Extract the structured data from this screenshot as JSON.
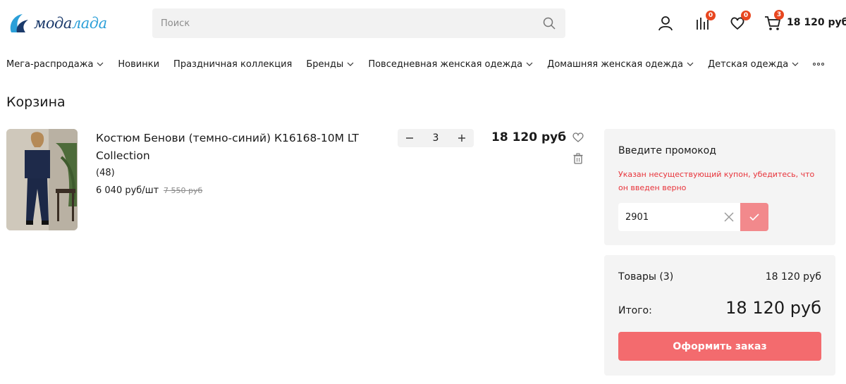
{
  "brand": {
    "logo_prefix": "мода",
    "logo_suffix": "лада",
    "accent": "#2b9fd8",
    "primary": "#1b3a6b"
  },
  "search": {
    "placeholder": "Поиск",
    "value": ""
  },
  "header": {
    "icons": [
      "user-icon",
      "compare-icon",
      "heart-icon",
      "cart-icon"
    ],
    "compare_count": "0",
    "favorites_count": "0",
    "cart_count": "3",
    "cart_total": "18 120 руб",
    "badge_color": "#e8461f"
  },
  "nav": {
    "items": [
      {
        "label": "Мега-распродажа",
        "has_dropdown": true
      },
      {
        "label": "Новинки",
        "has_dropdown": false
      },
      {
        "label": "Праздничная коллекция",
        "has_dropdown": false
      },
      {
        "label": "Бренды",
        "has_dropdown": true
      },
      {
        "label": "Повседневная женская одежда",
        "has_dropdown": true
      },
      {
        "label": "Домашняя женская одежда",
        "has_dropdown": true
      },
      {
        "label": "Детская одежда",
        "has_dropdown": true
      }
    ]
  },
  "page": {
    "title": "Корзина"
  },
  "cart": {
    "items": [
      {
        "name": "Костюм Бенови (темно-синий) К16168-10М LT Collection",
        "reviews": "(48)",
        "unit_price": "6 040 руб/шт",
        "old_price": "7 550 руб",
        "quantity": "3",
        "line_total": "18 120 руб"
      }
    ]
  },
  "promo": {
    "title": "Введите промокод",
    "error": "Указан несуществующий купон, убедитесь, что он введен верно",
    "value": "2901",
    "error_color": "#e8333a",
    "apply_color": "#f2898c"
  },
  "summary": {
    "goods_label": "Товары (3)",
    "goods_value": "18 120 руб",
    "total_label": "Итого:",
    "total_value": "18 120 руб",
    "checkout_label": "Оформить заказ",
    "checkout_color": "#f36b6e"
  }
}
